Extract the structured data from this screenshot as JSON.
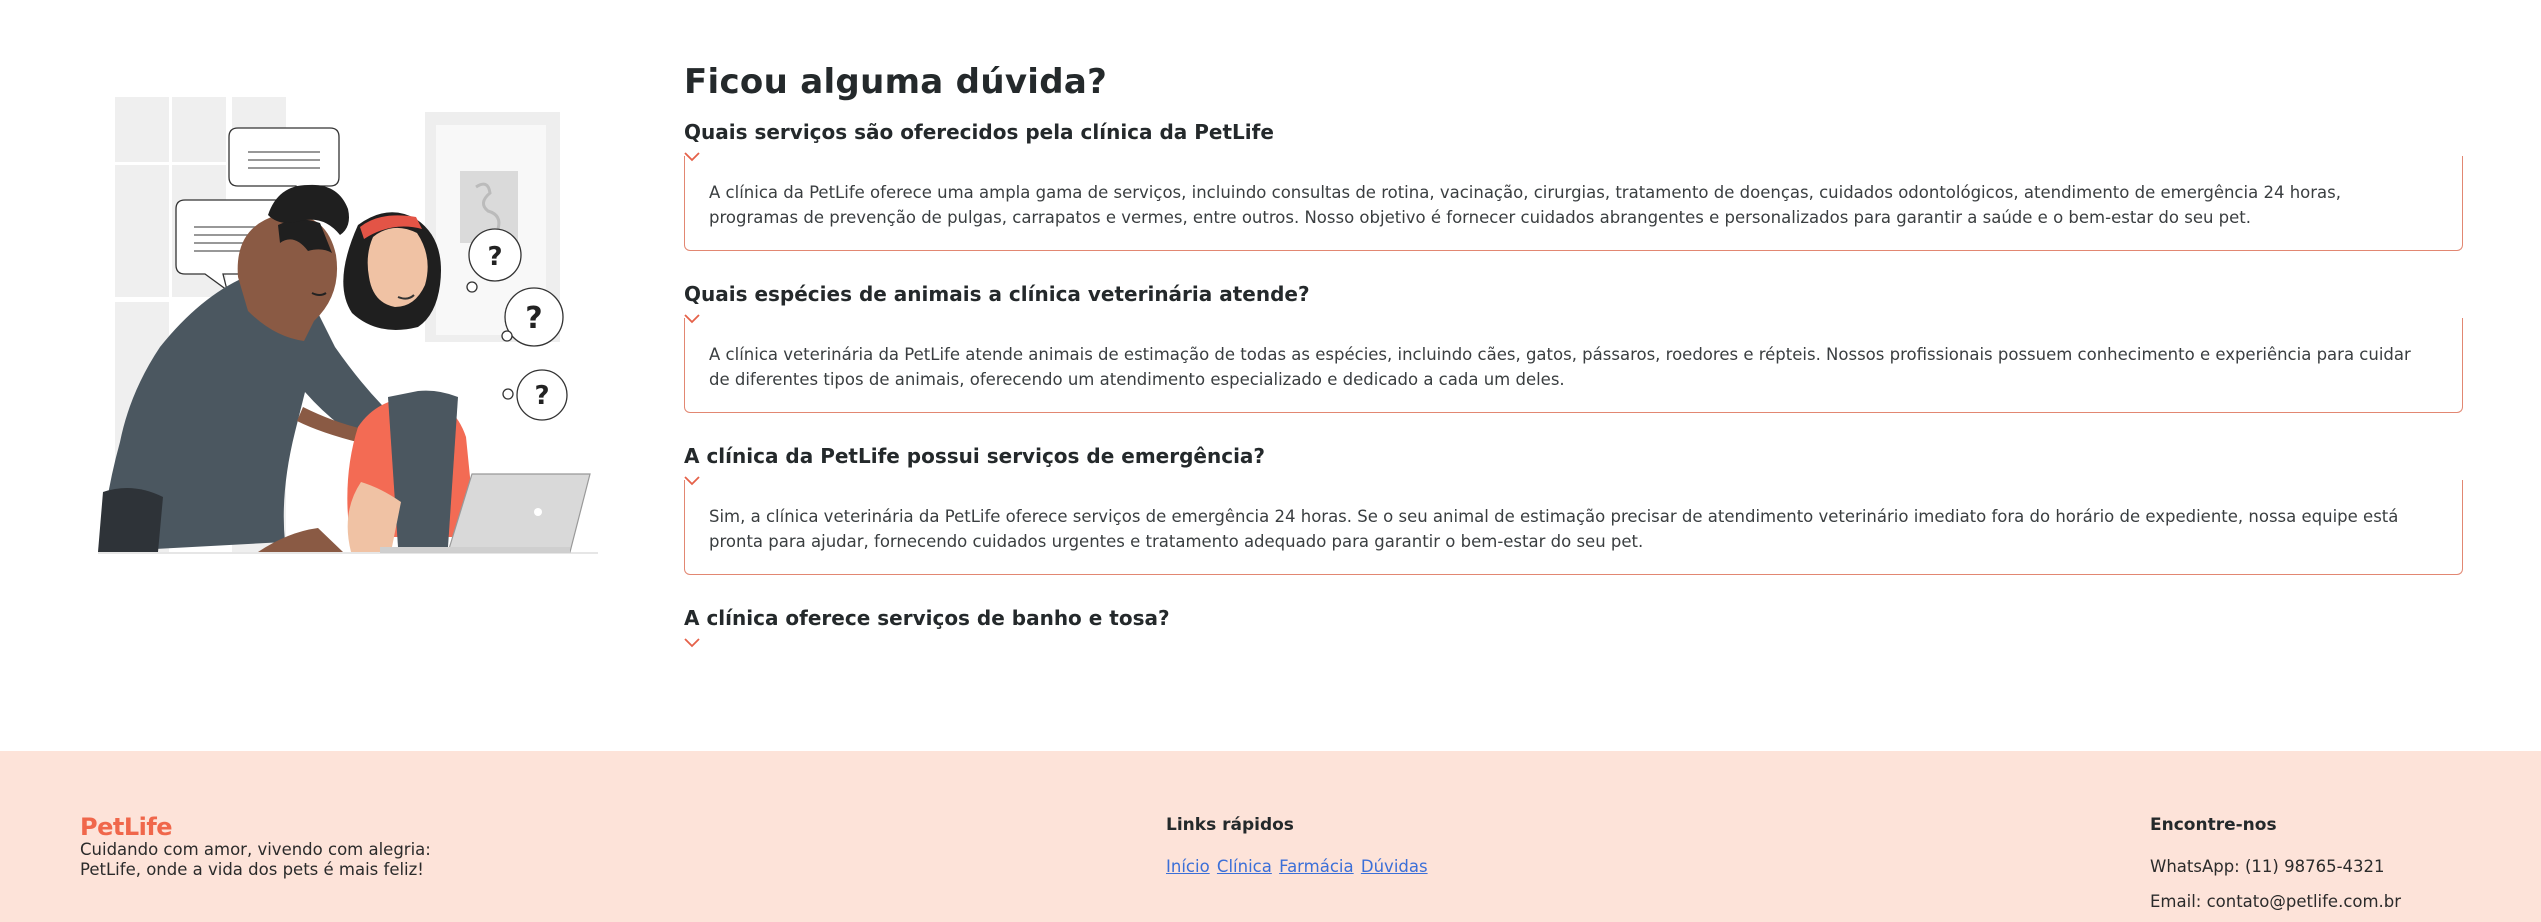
{
  "faq": {
    "title": "Ficou alguma dúvida?",
    "items": [
      {
        "question": "Quais serviços são oferecidos pela clínica da PetLife",
        "answer": "A clínica da PetLife oferece uma ampla gama de serviços, incluindo consultas de rotina, vacinação, cirurgias, tratamento de doenças, cuidados odontológicos, atendimento de emergência 24 horas, programas de prevenção de pulgas, carrapatos e vermes, entre outros. Nosso objetivo é fornecer cuidados abrangentes e personalizados para garantir a saúde e o bem-estar do seu pet.",
        "expanded": true
      },
      {
        "question": "Quais espécies de animais a clínica veterinária atende?",
        "answer": "A clínica veterinária da PetLife atende animais de estimação de todas as espécies, incluindo cães, gatos, pássaros, roedores e répteis. Nossos profissionais possuem conhecimento e experiência para cuidar de diferentes tipos de animais, oferecendo um atendimento especializado e dedicado a cada um deles.",
        "expanded": true
      },
      {
        "question": "A clínica da PetLife possui serviços de emergência?",
        "answer": "Sim, a clínica veterinária da PetLife oferece serviços de emergência 24 horas. Se o seu animal de estimação precisar de atendimento veterinário imediato fora do horário de expediente, nossa equipe está pronta para ajudar, fornecendo cuidados urgentes e tratamento adequado para garantir o bem-estar do seu pet.",
        "expanded": true
      },
      {
        "question": "A clínica oferece serviços de banho e tosa?",
        "expanded": false
      }
    ]
  },
  "illustration": {
    "question_marks": [
      "?",
      "?",
      "?"
    ]
  },
  "footer": {
    "brand": "PetLife",
    "tagline": "Cuidando com amor, vivendo com alegria: PetLife, onde a vida dos pets é mais feliz!",
    "links_title": "Links rápidos",
    "links": [
      "Início",
      "Clínica",
      "Farmácia",
      "Dúvidas"
    ],
    "contact_title": "Encontre-nos",
    "whatsapp": "WhatsApp: (11) 98765-4321",
    "email": "Email: contato@petlife.com.br"
  },
  "colors": {
    "accent": "#f0674b",
    "border": "#e28772",
    "footer_bg": "#fde3d9",
    "link": "#3b6fd8"
  }
}
